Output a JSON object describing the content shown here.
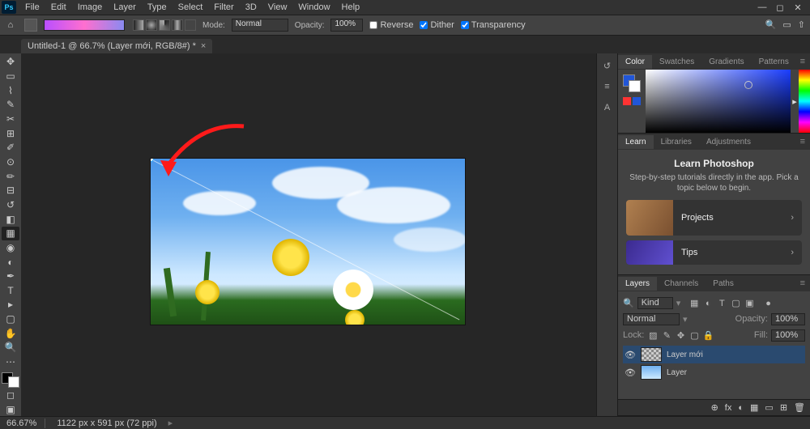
{
  "app": {
    "logo": "Ps"
  },
  "menu": [
    "File",
    "Edit",
    "Image",
    "Layer",
    "Type",
    "Select",
    "Filter",
    "3D",
    "View",
    "Window",
    "Help"
  ],
  "optbar": {
    "mode_label": "Mode:",
    "mode_value": "Normal",
    "opacity_label": "Opacity:",
    "opacity_value": "100%",
    "reverse_label": "Reverse",
    "dither_label": "Dither",
    "transparency_label": "Transparency"
  },
  "doc_tab": {
    "title": "Untitled-1 @ 66.7% (Layer mới, RGB/8#) *"
  },
  "status": {
    "zoom": "66.67%",
    "dims": "1122 px x 591 px (72 ppi)"
  },
  "panels": {
    "color": {
      "tabs": [
        "Color",
        "Swatches",
        "Gradients",
        "Patterns"
      ]
    },
    "learn": {
      "tabs": [
        "Learn",
        "Libraries",
        "Adjustments"
      ],
      "heading": "Learn Photoshop",
      "sub": "Step-by-step tutorials directly in the app. Pick a topic below to begin.",
      "cards": [
        {
          "title": "Projects"
        },
        {
          "title": "Tips"
        }
      ]
    },
    "layers": {
      "tabs": [
        "Layers",
        "Channels",
        "Paths"
      ],
      "kind_label": "Kind",
      "blend_value": "Normal",
      "opacity_label": "Opacity:",
      "opacity_value": "100%",
      "lock_label": "Lock:",
      "fill_label": "Fill:",
      "fill_value": "100%",
      "items": [
        {
          "name": "Layer mới",
          "active": true
        },
        {
          "name": "Layer",
          "active": false
        }
      ],
      "footer_icons": [
        "⊕",
        "fx",
        "◐",
        "▦",
        "▭",
        "⊞",
        "🗑"
      ]
    }
  }
}
